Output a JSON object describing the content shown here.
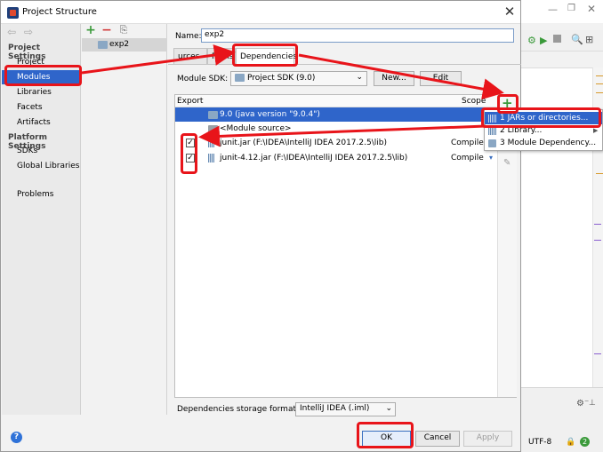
{
  "dialog": {
    "title": "Project Structure",
    "close_glyph": "✕"
  },
  "nav": {
    "back_glyph": "⇦",
    "forward_glyph": "⇨",
    "project_settings_heading": "Project Settings",
    "platform_settings_heading": "Platform Settings",
    "project_settings": [
      {
        "label": "Project"
      },
      {
        "label": "Modules"
      },
      {
        "label": "Libraries"
      },
      {
        "label": "Facets"
      },
      {
        "label": "Artifacts"
      }
    ],
    "platform_settings": [
      {
        "label": "SDKs"
      },
      {
        "label": "Global Libraries"
      }
    ],
    "problems": "Problems",
    "selected": "Modules"
  },
  "module_list": {
    "add_glyph": "+",
    "remove_glyph": "−",
    "copy_glyph": "⎘",
    "modules": [
      "exp2"
    ]
  },
  "module": {
    "name_label": "Name:",
    "name_value": "exp2",
    "tabs": [
      "urces",
      "Paths",
      "Dependencies"
    ],
    "active_tab": "Dependencies",
    "sdk_label": "Module SDK:",
    "sdk_value": "Project SDK (9.0)",
    "new_button": "New...",
    "edit_button": "Edit",
    "export_header": "Export",
    "scope_header": "Scope",
    "dependencies": [
      {
        "text": "9.0 (java version \"9.0.4\")",
        "scope": "",
        "checked": null
      },
      {
        "text": "<Module source>",
        "scope": "",
        "checked": null
      },
      {
        "text": "junit.jar (F:\\IDEA\\IntelliJ IDEA 2017.2.5\\lib)",
        "scope": "Compile",
        "checked": true
      },
      {
        "text": "junit-4.12.jar (F:\\IDEA\\IntelliJ IDEA 2017.2.5\\lib)",
        "scope": "Compile",
        "checked": true
      }
    ],
    "storage_label": "Dependencies storage format:",
    "storage_value": "IntelliJ IDEA (.iml)"
  },
  "popup": {
    "items": [
      {
        "label": "1  JARs or directories..."
      },
      {
        "label": "2  Library..."
      },
      {
        "label": "3  Module Dependency..."
      }
    ]
  },
  "buttons": {
    "ok": "OK",
    "cancel": "Cancel",
    "apply": "Apply",
    "help_glyph": "?"
  },
  "background_ide": {
    "encoding": "UTF-8",
    "badge": "2"
  },
  "colors": {
    "selection": "#2f65ca",
    "annotation": "#e8141a",
    "add_green": "#3a9a3a",
    "remove_red": "#d23a3a"
  }
}
